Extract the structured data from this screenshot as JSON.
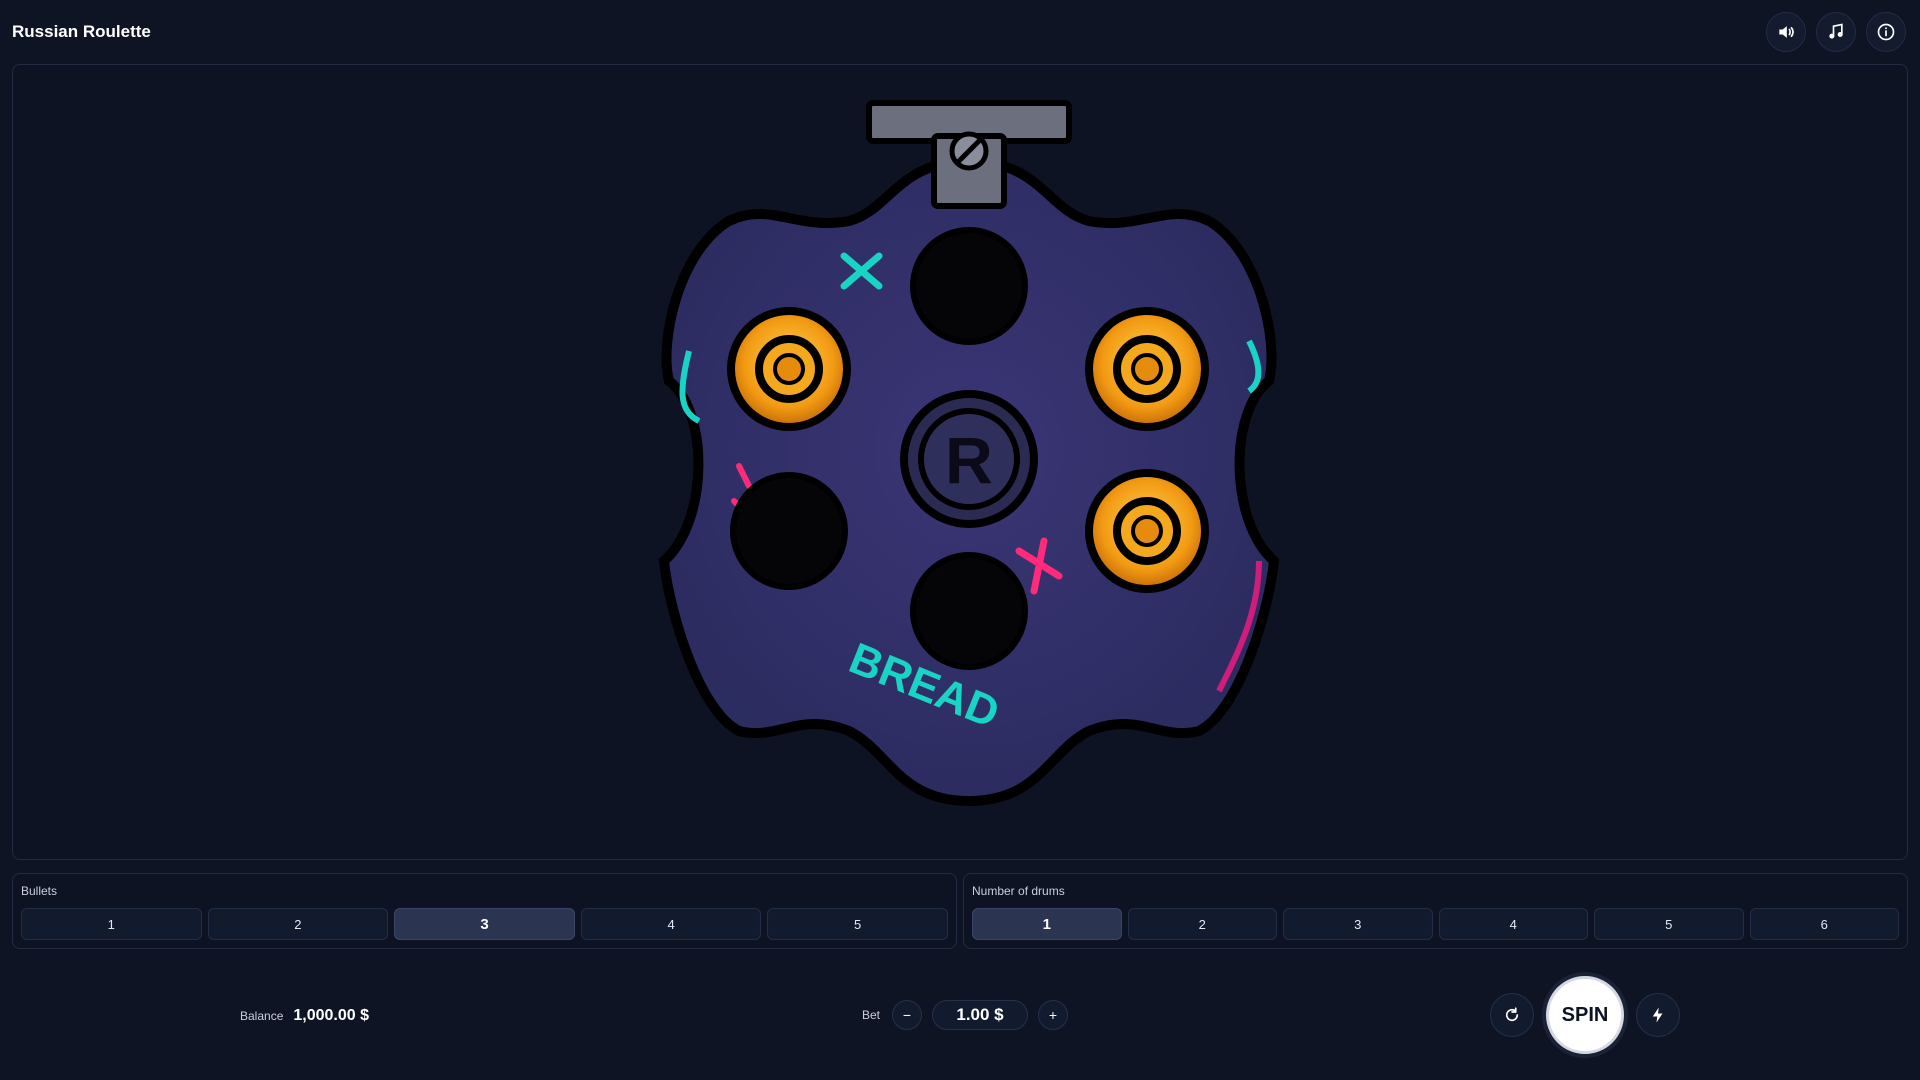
{
  "app": {
    "title": "Russian Roulette"
  },
  "top_icons": [
    "speaker-icon",
    "music-note-icon",
    "info-icon"
  ],
  "cylinder": {
    "chambers_loaded": [
      false,
      true,
      true,
      true,
      false,
      false
    ],
    "graffiti_text": "BREAD",
    "emblem_letter": "R"
  },
  "bullets": {
    "label": "Bullets",
    "options": [
      "1",
      "2",
      "3",
      "4",
      "5"
    ],
    "selected": "3"
  },
  "drums": {
    "label": "Number of drums",
    "options": [
      "1",
      "2",
      "3",
      "4",
      "5",
      "6"
    ],
    "selected": "1"
  },
  "balance": {
    "label": "Balance",
    "value": "1,000.00 $"
  },
  "bet": {
    "label": "Bet",
    "value": "1.00 $",
    "minus": "−",
    "plus": "+"
  },
  "actions": {
    "spin_label": "SPIN",
    "repeat_icon": "repeat-icon",
    "turbo_icon": "lightning-icon"
  },
  "colors": {
    "background": "#0e1424",
    "cylinder_fill": "#3a3370",
    "bullet_gold": "#f2a21c",
    "accent_teal": "#19d3c5",
    "accent_pink": "#ff2a7a"
  }
}
